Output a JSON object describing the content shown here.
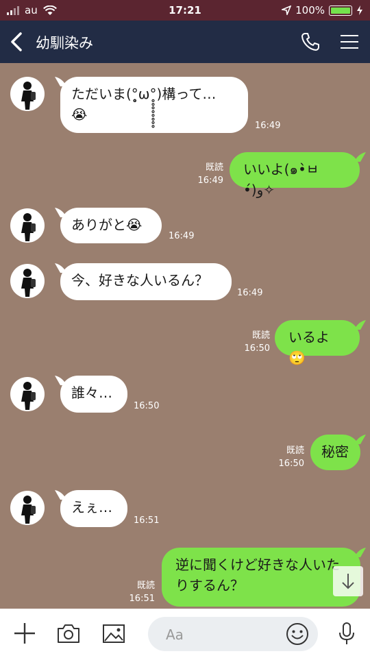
{
  "status_bar": {
    "carrier": "au",
    "time": "17:21",
    "battery": "100%"
  },
  "header": {
    "title": "幼馴染み"
  },
  "messages": [
    {
      "side": "in",
      "text_line1": "ただいま(°̥̥̥̥̥̥̥̥ω°̥̥̥̥̥̥̥̥)構って…",
      "text_line2": "😭",
      "time": "16:49"
    },
    {
      "side": "out",
      "text": "いいよ(๑•̀ㅂ•́)و✧",
      "read": "既読",
      "time": "16:49"
    },
    {
      "side": "in",
      "text": "ありがと😭",
      "time": "16:49"
    },
    {
      "side": "in",
      "text": "今、好きな人いるん？",
      "time": "16:49"
    },
    {
      "side": "out",
      "text": "いるよ🙄",
      "read": "既読",
      "time": "16:50"
    },
    {
      "side": "in",
      "text": "誰々…",
      "time": "16:50"
    },
    {
      "side": "out",
      "text": "秘密",
      "read": "既読",
      "time": "16:50"
    },
    {
      "side": "in",
      "text": "えぇ…",
      "time": "16:51"
    },
    {
      "side": "out",
      "text_line1": "逆に聞くけど好きな人いた",
      "text_line2": "りするん？",
      "read": "既読",
      "time": "16:51"
    }
  ],
  "input": {
    "placeholder": "Aa"
  },
  "colors": {
    "status_bg": "#5b2530",
    "header_bg": "#222c45",
    "chat_bg": "#9a7f6f",
    "bubble_out": "#7ee24a",
    "bubble_in": "#ffffff"
  }
}
